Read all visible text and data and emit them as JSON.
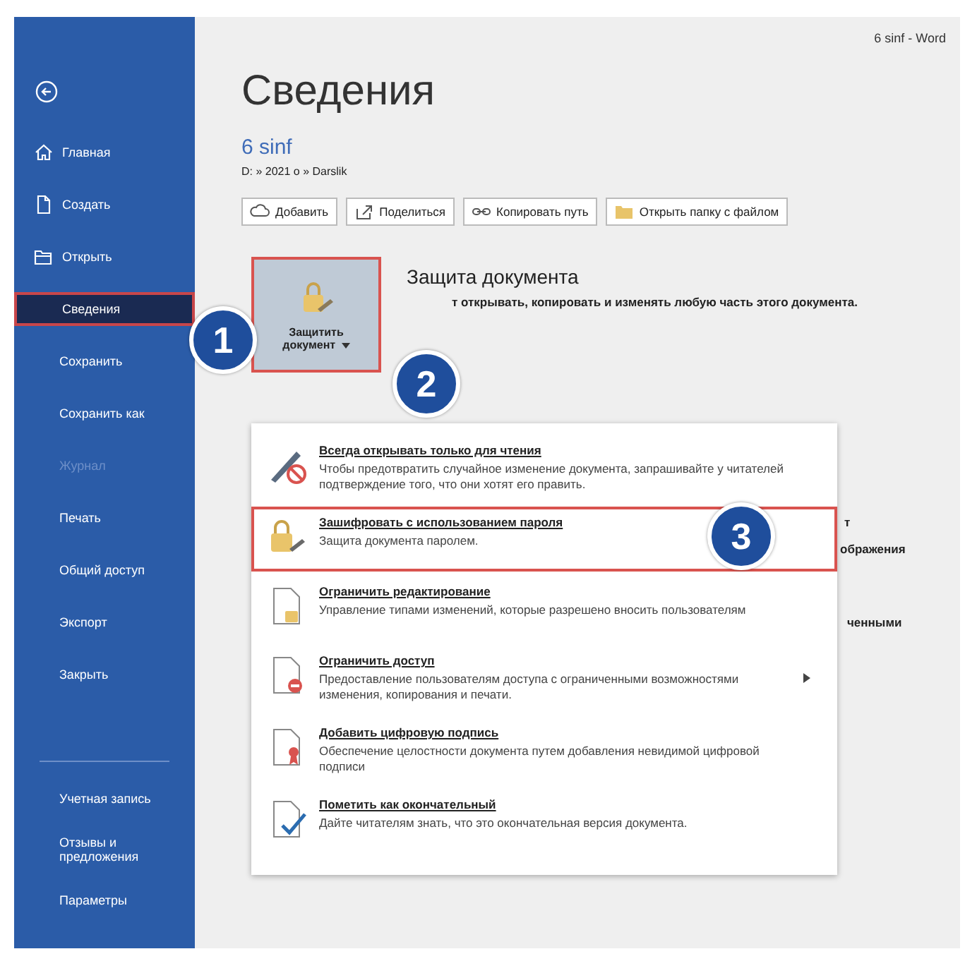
{
  "window": {
    "title": "6 sinf  -  Word"
  },
  "sidebar": {
    "items": [
      {
        "kind": "icon_link",
        "label": "Главная",
        "selected": false,
        "disabled": false
      },
      {
        "kind": "icon_link",
        "label": "Создать",
        "selected": false,
        "disabled": false
      },
      {
        "kind": "icon_link",
        "label": "Открыть",
        "selected": false,
        "disabled": false
      },
      {
        "kind": "link",
        "label": "Сведения",
        "selected": true,
        "disabled": false
      },
      {
        "kind": "link",
        "label": "Сохранить",
        "selected": false,
        "disabled": false
      },
      {
        "kind": "link",
        "label": "Сохранить как",
        "selected": false,
        "disabled": false
      },
      {
        "kind": "link",
        "label": "Журнал",
        "selected": false,
        "disabled": true
      },
      {
        "kind": "link",
        "label": "Печать",
        "selected": false,
        "disabled": false
      },
      {
        "kind": "link",
        "label": "Общий доступ",
        "selected": false,
        "disabled": false
      },
      {
        "kind": "link",
        "label": "Экспорт",
        "selected": false,
        "disabled": false
      },
      {
        "kind": "link",
        "label": "Закрыть",
        "selected": false,
        "disabled": false
      }
    ],
    "bottom_items": [
      {
        "label": "Учетная запись"
      },
      {
        "label": "Отзывы и предложения"
      },
      {
        "label": "Параметры"
      }
    ]
  },
  "page": {
    "heading": "Сведения",
    "document_name": "6 sinf",
    "path": "D: » 2021 o » Darslik",
    "toolbar": [
      "Добавить",
      "Поделиться",
      "Копировать путь",
      "Открыть папку с файлом"
    ],
    "protect": {
      "button": "Защитить документ",
      "heading": "Защита документа",
      "description": "т открывать, копировать и изменять любую часть этого документа."
    },
    "covered_fragments": [
      "т",
      "ображения",
      "ченными"
    ]
  },
  "menu": {
    "items": [
      {
        "title": "Всегда открывать только для чтения",
        "description": "Чтобы предотвратить случайное изменение документа, запрашивайте у читателей подтверждение того, что они хотят его править.",
        "selected": false,
        "submenu": false
      },
      {
        "title": "Зашифровать с использованием пароля",
        "description": "Защита документа паролем.",
        "selected": true,
        "submenu": false
      },
      {
        "title": "Ограничить редактирование",
        "description": "Управление типами изменений, которые разрешено вносить пользователям",
        "selected": false,
        "submenu": false
      },
      {
        "title": "Ограничить доступ",
        "description": "Предоставление пользователям доступа с ограниченными возможностями изменения, копирования и печати.",
        "selected": false,
        "submenu": true
      },
      {
        "title": "Добавить цифровую подпись",
        "description": "Обеспечение целостности документа путем добавления невидимой цифровой подписи",
        "selected": false,
        "submenu": false
      },
      {
        "title": "Пометить как окончательный",
        "description": "Дайте читателям знать, что это окончательная версия документа.",
        "selected": false,
        "submenu": false
      }
    ]
  },
  "callouts": [
    "1",
    "2",
    "3"
  ]
}
